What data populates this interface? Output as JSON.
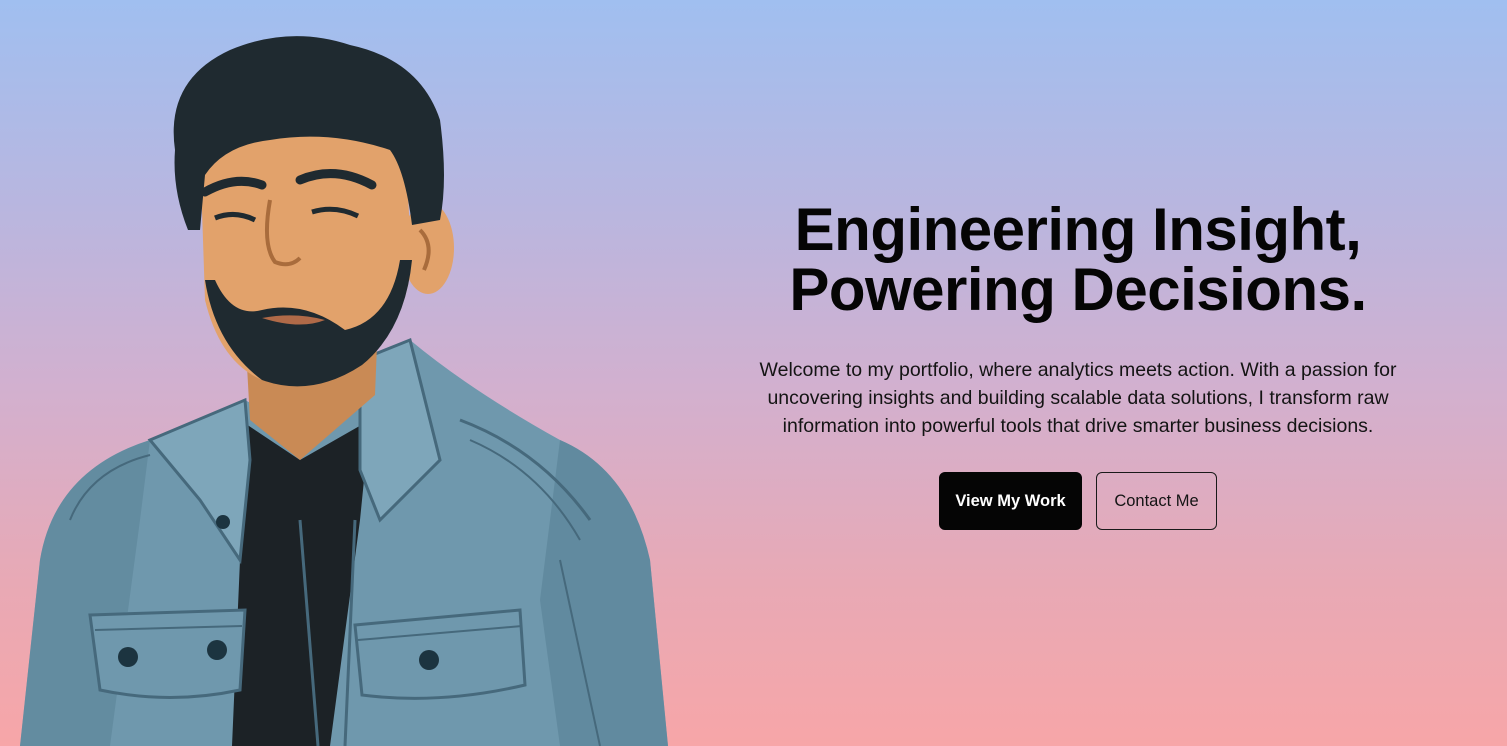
{
  "hero": {
    "headline_line1": "Engineering Insight,",
    "headline_line2": "Powering Decisions.",
    "intro": "Welcome to my portfolio, where analytics meets action. With a passion for uncovering insights and building scalable data solutions, I transform raw information into powerful tools that drive smarter business decisions.",
    "primary_button": "View My Work",
    "secondary_button": "Contact Me",
    "portrait_icon": "man-portrait-illustration"
  },
  "colors": {
    "background_top": "#a0bff0",
    "background_bottom": "#f7a6a8",
    "primary_button_bg": "#050505",
    "text": "#050505",
    "jacket": "#6f98ad",
    "skin": "#e2a26b",
    "hair": "#1f2a30"
  }
}
